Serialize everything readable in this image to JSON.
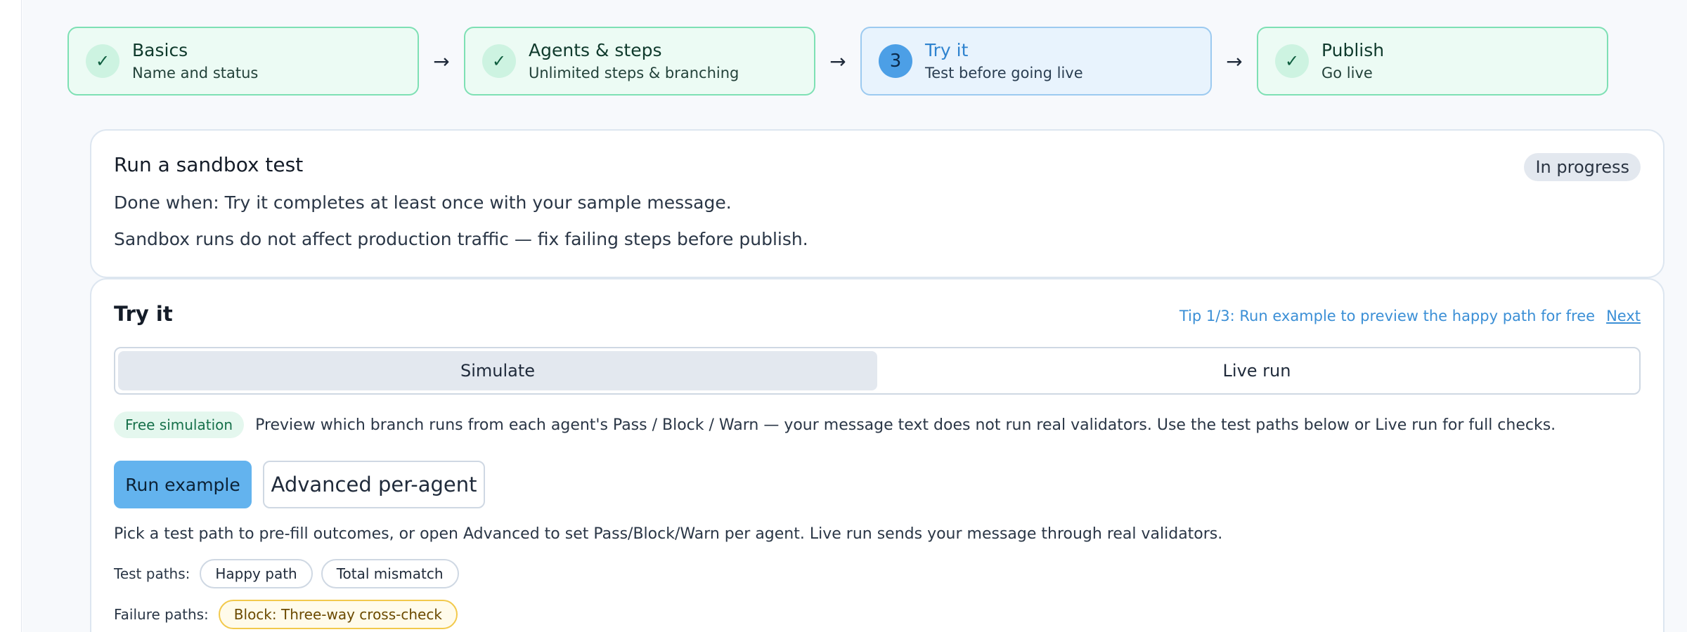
{
  "stepper": {
    "steps": [
      {
        "title": "Basics",
        "subtitle": "Name and status",
        "badge": "✓"
      },
      {
        "title": "Agents & steps",
        "subtitle": "Unlimited steps & branching",
        "badge": "✓"
      },
      {
        "title": "Try it",
        "subtitle": "Test before going live",
        "badge": "3"
      },
      {
        "title": "Publish",
        "subtitle": "Go live",
        "badge": "✓"
      }
    ],
    "arrow": "→"
  },
  "sandbox": {
    "title": "Run a sandbox test",
    "status": "In progress",
    "done_when": "Done when: Try it completes at least once with your sample message.",
    "note": "Sandbox runs do not affect production traffic — fix failing steps before publish."
  },
  "tryit": {
    "title": "Try it",
    "tip": "Tip 1/3: Run example to preview the happy path for free",
    "tip_next": "Next",
    "modes": [
      "Simulate",
      "Live run"
    ],
    "selected_mode": "Simulate",
    "free_badge": "Free simulation",
    "sim_description": "Preview which branch runs from each agent's Pass / Block / Warn — your message text does not run real validators. Use the test paths below or Live run for full checks.",
    "run_example": "Run example",
    "advanced": "Advanced per-agent",
    "help": "Pick a test path to pre-fill outcomes, or open Advanced to set Pass/Block/Warn per agent. Live run sends your message through real validators.",
    "test_paths_label": "Test paths:",
    "test_paths": [
      "Happy path",
      "Total mismatch"
    ],
    "failure_paths_label": "Failure paths:",
    "failure_paths": [
      "Block: Three-way cross-check"
    ]
  },
  "colors": {
    "complete_border": "#7ee0b4",
    "active_border": "#9ccaf0",
    "primary": "#63b3ee",
    "link": "#3b8fd6",
    "warn_chip_border": "#f2c94c"
  }
}
